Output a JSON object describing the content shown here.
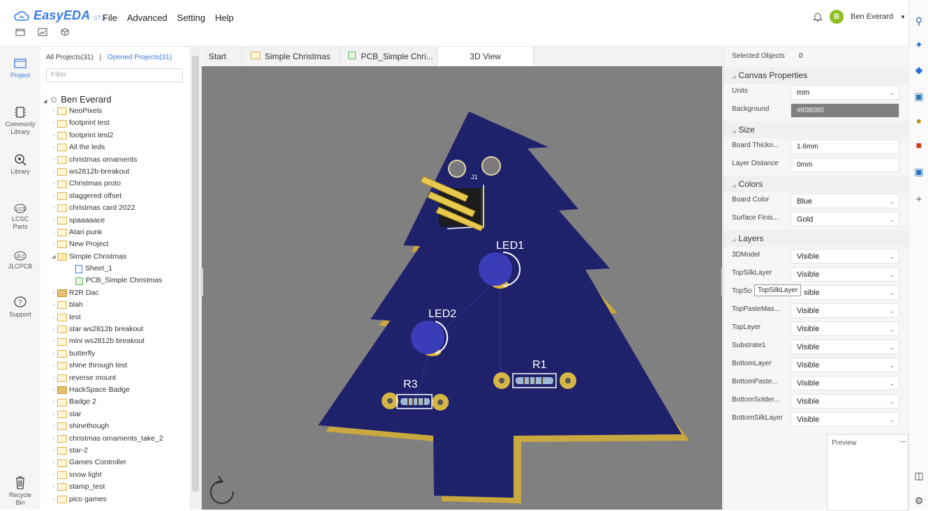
{
  "app": {
    "logo_text": "EasyEDA",
    "logo_sub": "STD",
    "menu": [
      "File",
      "Advanced",
      "Setting",
      "Help"
    ],
    "user_initial": "B",
    "user_name": "Ben Everard"
  },
  "leftnav": [
    {
      "label": "Project",
      "icon": "folder-icon"
    },
    {
      "label": "Commonly Library",
      "icon": "chip-icon"
    },
    {
      "label": "Library",
      "icon": "search-icon"
    },
    {
      "label": "LCSC Parts",
      "icon": "lcsc-icon"
    },
    {
      "label": "JLCPCB",
      "icon": "jlc-icon"
    },
    {
      "label": "Support",
      "icon": "help-icon"
    },
    {
      "label": "Recycle Bin",
      "icon": "trash-icon"
    }
  ],
  "project_panel": {
    "tab_all": "All Projects(31)",
    "separator": "|",
    "tab_opened": "Opened Projects(31)",
    "filter_placeholder": "Filter",
    "owner": "Ben Everard",
    "items": [
      {
        "label": "NeoPixels",
        "type": "folder"
      },
      {
        "label": "footprint test",
        "type": "folder"
      },
      {
        "label": "footprint test2",
        "type": "folder"
      },
      {
        "label": "All the leds",
        "type": "folder"
      },
      {
        "label": "christmas ornaments",
        "type": "folder"
      },
      {
        "label": "ws2812b-breakout",
        "type": "folder"
      },
      {
        "label": "Christmas proto",
        "type": "folder"
      },
      {
        "label": "staggered offset",
        "type": "folder"
      },
      {
        "label": "christmas card 2022",
        "type": "folder"
      },
      {
        "label": "spaaaaace",
        "type": "folder"
      },
      {
        "label": "Atari punk",
        "type": "folder"
      },
      {
        "label": "New Project",
        "type": "folder"
      },
      {
        "label": "Simple Christmas",
        "type": "folder-open"
      },
      {
        "label": "Sheet_1",
        "type": "sheet"
      },
      {
        "label": "PCB_Simple Christmas",
        "type": "pcb"
      },
      {
        "label": "R2R Dac",
        "type": "shared"
      },
      {
        "label": "blah",
        "type": "folder"
      },
      {
        "label": "test",
        "type": "folder"
      },
      {
        "label": "star ws2812b breakout",
        "type": "folder"
      },
      {
        "label": "mini ws2812b breakout",
        "type": "folder"
      },
      {
        "label": "butterfly",
        "type": "folder"
      },
      {
        "label": "shine through test",
        "type": "folder"
      },
      {
        "label": "reverse mount",
        "type": "folder"
      },
      {
        "label": "HackSpace Badge",
        "type": "shared"
      },
      {
        "label": "Badge 2",
        "type": "folder"
      },
      {
        "label": "star",
        "type": "folder"
      },
      {
        "label": "shinethough",
        "type": "folder"
      },
      {
        "label": "christmas ornaments_take_2",
        "type": "folder"
      },
      {
        "label": "star-2",
        "type": "folder"
      },
      {
        "label": "Games Controller",
        "type": "folder"
      },
      {
        "label": "snow light",
        "type": "folder"
      },
      {
        "label": "stamp_test",
        "type": "folder"
      },
      {
        "label": "pico games",
        "type": "folder"
      }
    ]
  },
  "tabs": [
    "Start",
    "Simple Christmas",
    "PCB_Simple Chri...",
    "3D View"
  ],
  "canvas": {
    "labels": {
      "led1": "LED1",
      "led2": "LED2",
      "r1": "R1",
      "r3": "R3",
      "j1": "J1"
    }
  },
  "props": {
    "selected_label": "Selected Objects",
    "selected_count": "0",
    "canvas_section": "Canvas Properties",
    "units_label": "Units",
    "units_value": "mm",
    "background_label": "Background",
    "background_value": "#808080",
    "size_section": "Size",
    "thickness_label": "Board Thickn...",
    "thickness_value": "1.6mm",
    "layer_distance_label": "Layer Distance",
    "layer_distance_value": "0mm",
    "colors_section": "Colors",
    "board_color_label": "Board Color",
    "board_color_value": "Blue",
    "surface_label": "Surface Finis...",
    "surface_value": "Gold",
    "layers_section": "Layers",
    "layers": [
      {
        "label": "3DModel",
        "value": "Visible"
      },
      {
        "label": "TopSilkLayer",
        "value": "Visible"
      },
      {
        "label": "TopSo",
        "value": "sible"
      },
      {
        "label": "TopPasteMas...",
        "value": "Visible"
      },
      {
        "label": "TopLayer",
        "value": "Visible"
      },
      {
        "label": "Substrate1",
        "value": "Visible"
      },
      {
        "label": "BottomLayer",
        "value": "Visible"
      },
      {
        "label": "BottomPaste...",
        "value": "Visible"
      },
      {
        "label": "BottomSolder...",
        "value": "Visible"
      },
      {
        "label": "BottomSilkLayer",
        "value": "Visible"
      }
    ],
    "tooltip": "TopSilkLayer",
    "preview_label": "Preview",
    "preview_dash": "—"
  },
  "colors": {
    "board": "#1f226b",
    "canvas": "#808080",
    "gold": "#d6b645",
    "accent": "#3b7de0"
  }
}
